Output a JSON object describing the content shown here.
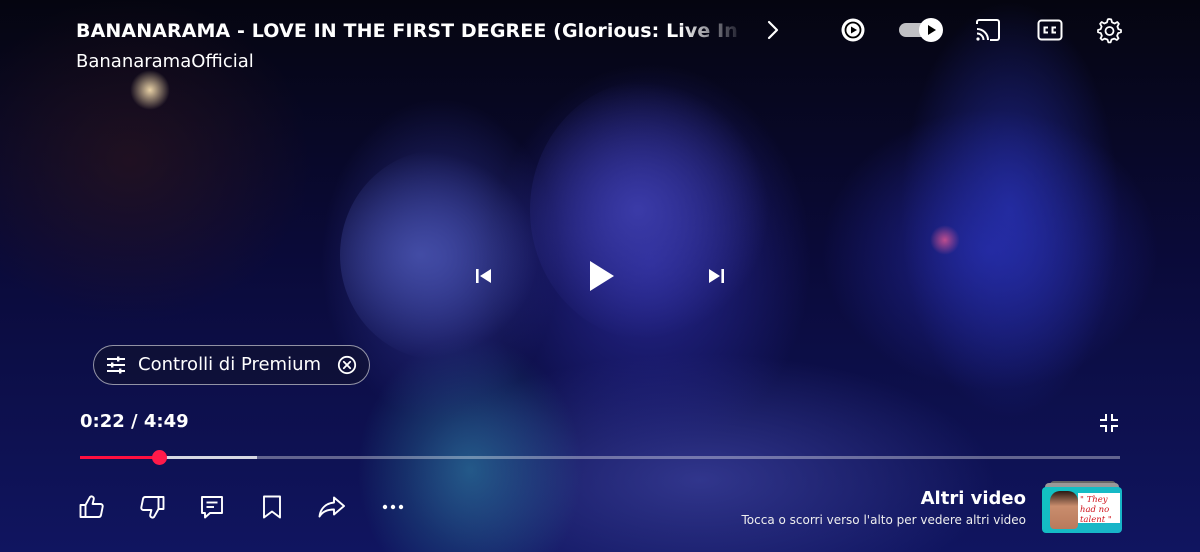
{
  "video": {
    "title": "BANANARAMA - LOVE IN THE FIRST DEGREE (Glorious: Live In London)",
    "channel": "BananaramaOfficial",
    "current_time": "0:22",
    "duration": "4:49",
    "time_display": "0:22 / 4:49",
    "progress_fraction": 0.0761,
    "buffered_fraction": 0.17,
    "progress_color": "#ff0f3f"
  },
  "top_controls": {
    "expand_icon": "chevron-right-icon",
    "icons": [
      "mini-player-icon",
      "autoplay-toggle",
      "cast-icon",
      "captions-icon",
      "settings-gear-icon"
    ],
    "autoplay_on": true
  },
  "center_controls": {
    "icons": [
      "previous-icon",
      "play-icon",
      "next-icon"
    ]
  },
  "premium_chip": {
    "label": "Controlli di Premium",
    "icon": "sliders-icon",
    "close_icon": "close-circle-icon"
  },
  "bottom_actions": {
    "icons": [
      "like-icon",
      "dislike-icon",
      "comments-icon",
      "save-icon",
      "share-icon",
      "more-icon"
    ]
  },
  "more_videos": {
    "title": "Altri video",
    "subtitle": "Tocca o scorri verso l'alto per vedere altri video",
    "thumbnail_text": "\" They had no talent \""
  }
}
